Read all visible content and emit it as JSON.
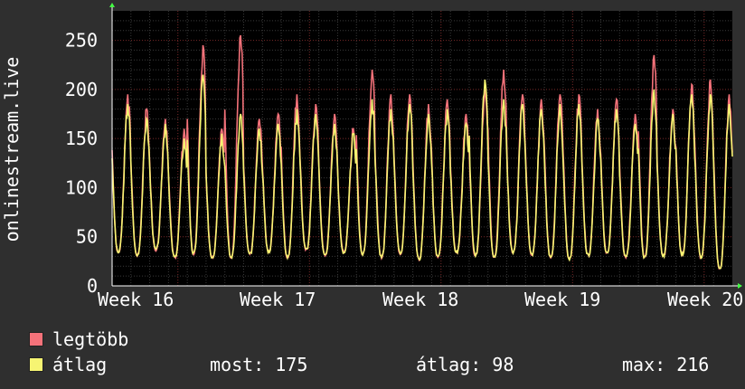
{
  "chart_data": {
    "type": "line",
    "ylabel": "onlinestream.live",
    "ylim": [
      0,
      280
    ],
    "yticks": [
      0,
      50,
      100,
      150,
      200,
      250
    ],
    "x_tick_labels": [
      "Week 16",
      "Week 17",
      "Week 18",
      "Week 19",
      "Week 20"
    ],
    "grid": true,
    "sample_interval": "1 hour daily cycle, ~33 days",
    "series": [
      {
        "name": "legtöbb",
        "color": "#f4727a",
        "daily_peaks": [
          195,
          180,
          170,
          160,
          245,
          160,
          255,
          170,
          175,
          195,
          185,
          175,
          160,
          220,
          195,
          195,
          185,
          190,
          175,
          200,
          220,
          195,
          190,
          195,
          195,
          180,
          190,
          175,
          235,
          180,
          205,
          210,
          195
        ]
      },
      {
        "name": "átlag",
        "color": "#f6f472",
        "daily_peaks": [
          185,
          170,
          165,
          150,
          215,
          155,
          175,
          160,
          165,
          180,
          175,
          165,
          155,
          190,
          180,
          185,
          175,
          180,
          165,
          210,
          190,
          185,
          180,
          185,
          185,
          170,
          180,
          165,
          200,
          175,
          195,
          195,
          185
        ]
      }
    ],
    "daily_troughs": [
      35,
      32,
      38,
      30,
      34,
      30,
      30,
      33,
      36,
      30,
      38,
      32,
      35,
      33,
      30,
      34,
      28,
      30,
      35,
      32,
      30,
      35,
      33,
      30,
      28,
      32,
      34,
      30,
      30,
      31,
      33,
      30,
      18
    ]
  },
  "legend": {
    "items": [
      {
        "label": "legtöbb",
        "color": "#f4727a"
      },
      {
        "label": "átlag",
        "color": "#f6f472"
      }
    ],
    "now": "most: 175",
    "avg": "átlag: 98",
    "max": "max: 216"
  }
}
